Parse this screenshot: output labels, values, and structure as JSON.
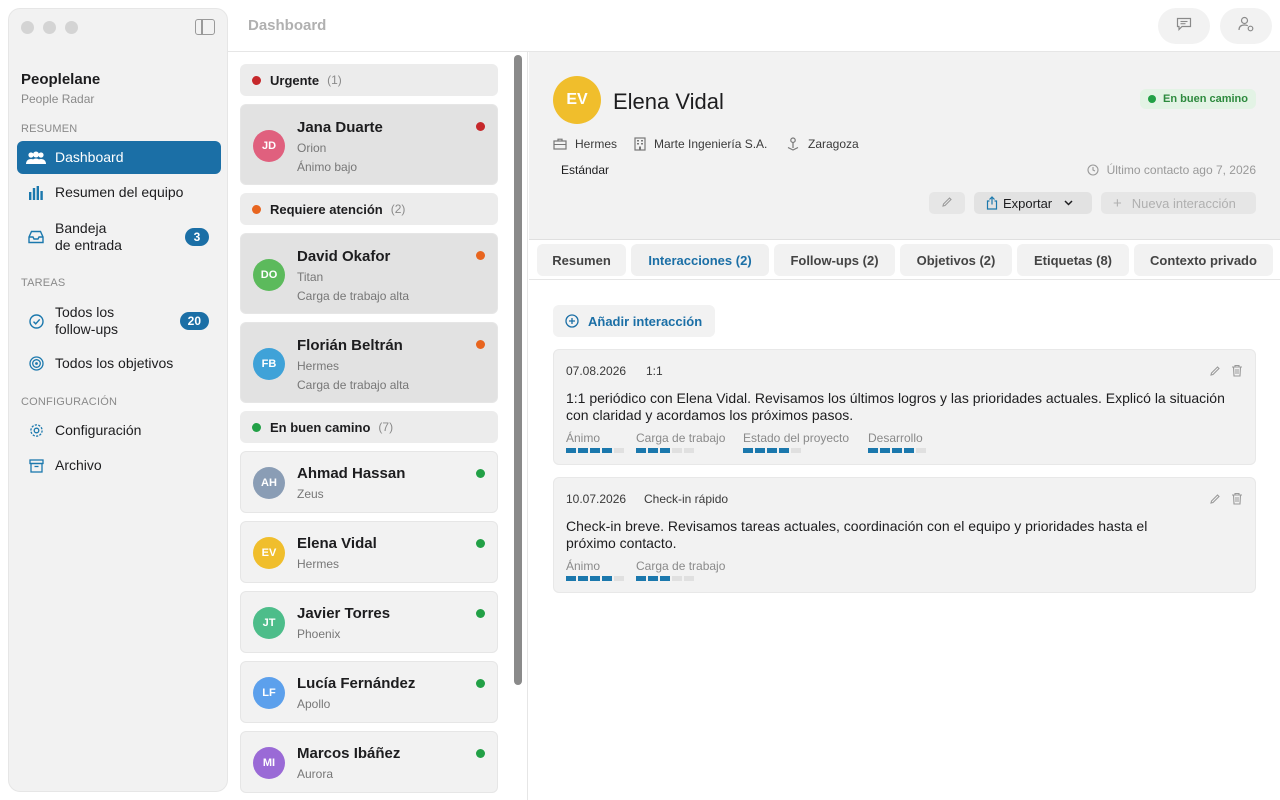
{
  "window": {
    "title": "Dashboard"
  },
  "sidebar": {
    "brand": "Peoplelane",
    "subtitle": "People Radar",
    "sections": {
      "summary": "RESUMEN",
      "tasks": "TAREAS",
      "config": "CONFIGURACIÓN"
    },
    "items": [
      {
        "label": "Dashboard",
        "icon": "people-icon",
        "active": true
      },
      {
        "label": "Resumen del equipo",
        "icon": "bar-chart-icon"
      },
      {
        "label": "Bandeja\nde entrada",
        "icon": "inbox-icon",
        "badge": "3"
      },
      {
        "label": "Todos los\nfollow-ups",
        "icon": "check-circle-icon",
        "badge": "20"
      },
      {
        "label": "Todos los objetivos",
        "icon": "target-icon"
      },
      {
        "label": "Configuración",
        "icon": "gear-icon"
      },
      {
        "label": "Archivo",
        "icon": "archive-icon"
      }
    ]
  },
  "groups": [
    {
      "label": "Urgente",
      "count": "(1)",
      "color": "#c6282b"
    },
    {
      "label": "Requiere atención",
      "count": "(2)",
      "color": "#e8651f"
    },
    {
      "label": "En buen camino",
      "count": "(7)",
      "color": "#22a046"
    }
  ],
  "people": [
    {
      "initials": "JD",
      "name": "Jana Duarte",
      "team": "Orion",
      "note": "Ánimo bajo",
      "color": "#e0607e",
      "status": "#c6282b"
    },
    {
      "initials": "DO",
      "name": "David Okafor",
      "team": "Titan",
      "note": "Carga de trabajo alta",
      "color": "#5cba5c",
      "status": "#e8651f"
    },
    {
      "initials": "FB",
      "name": "Florián Beltrán",
      "team": "Hermes",
      "note": "Carga de trabajo alta",
      "color": "#3fa2d8",
      "status": "#e8651f"
    },
    {
      "initials": "AH",
      "name": "Ahmad Hassan",
      "team": "Zeus",
      "color": "#8a9db5",
      "status": "#22a046"
    },
    {
      "initials": "EV",
      "name": "Elena Vidal",
      "team": "Hermes",
      "color": "#f0be2c",
      "status": "#22a046"
    },
    {
      "initials": "JT",
      "name": "Javier Torres",
      "team": "Phoenix",
      "color": "#4dbd8a",
      "status": "#22a046"
    },
    {
      "initials": "LF",
      "name": "Lucía Fernández",
      "team": "Apollo",
      "color": "#5ca0ec",
      "status": "#22a046"
    },
    {
      "initials": "MI",
      "name": "Marcos Ibáñez",
      "team": "Aurora",
      "color": "#9a6ad6",
      "status": "#22a046"
    }
  ],
  "detail": {
    "initials": "EV",
    "name": "Elena Vidal",
    "status": "En buen camino",
    "team": "Hermes",
    "company": "Marte Ingeniería S.A.",
    "location": "Zaragoza",
    "tier": "Estándar",
    "last_contact": "Último contacto ago 7, 2026",
    "export_label": "Exportar",
    "new_interaction_label": "Nueva interacción",
    "tabs": [
      "Resumen",
      "Interacciones (2)",
      "Follow-ups (2)",
      "Objetivos (2)",
      "Etiquetas (8)",
      "Contexto privado"
    ],
    "add_interaction_label": "Añadir interacción",
    "interactions": [
      {
        "date": "07.08.2026",
        "type": "1:1",
        "text": "1:1 periódico con Elena Vidal. Revisamos los últimos logros y las prioridades actuales. Explicó la situación con claridad y acordamos los próximos pasos.",
        "metrics": [
          {
            "label": "Ánimo",
            "value": 4,
            "max": 5
          },
          {
            "label": "Carga de trabajo",
            "value": 3,
            "max": 5
          },
          {
            "label": "Estado del proyecto",
            "value": 4,
            "max": 5
          },
          {
            "label": "Desarrollo",
            "value": 4,
            "max": 5
          }
        ]
      },
      {
        "date": "10.07.2026",
        "type": "Check-in rápido",
        "text": "Check-in breve. Revisamos tareas actuales, coordinación con el equipo y prioridades hasta el próximo contacto.",
        "metrics": [
          {
            "label": "Ánimo",
            "value": 4,
            "max": 5
          },
          {
            "label": "Carga de trabajo",
            "value": 3,
            "max": 5
          }
        ]
      }
    ]
  }
}
